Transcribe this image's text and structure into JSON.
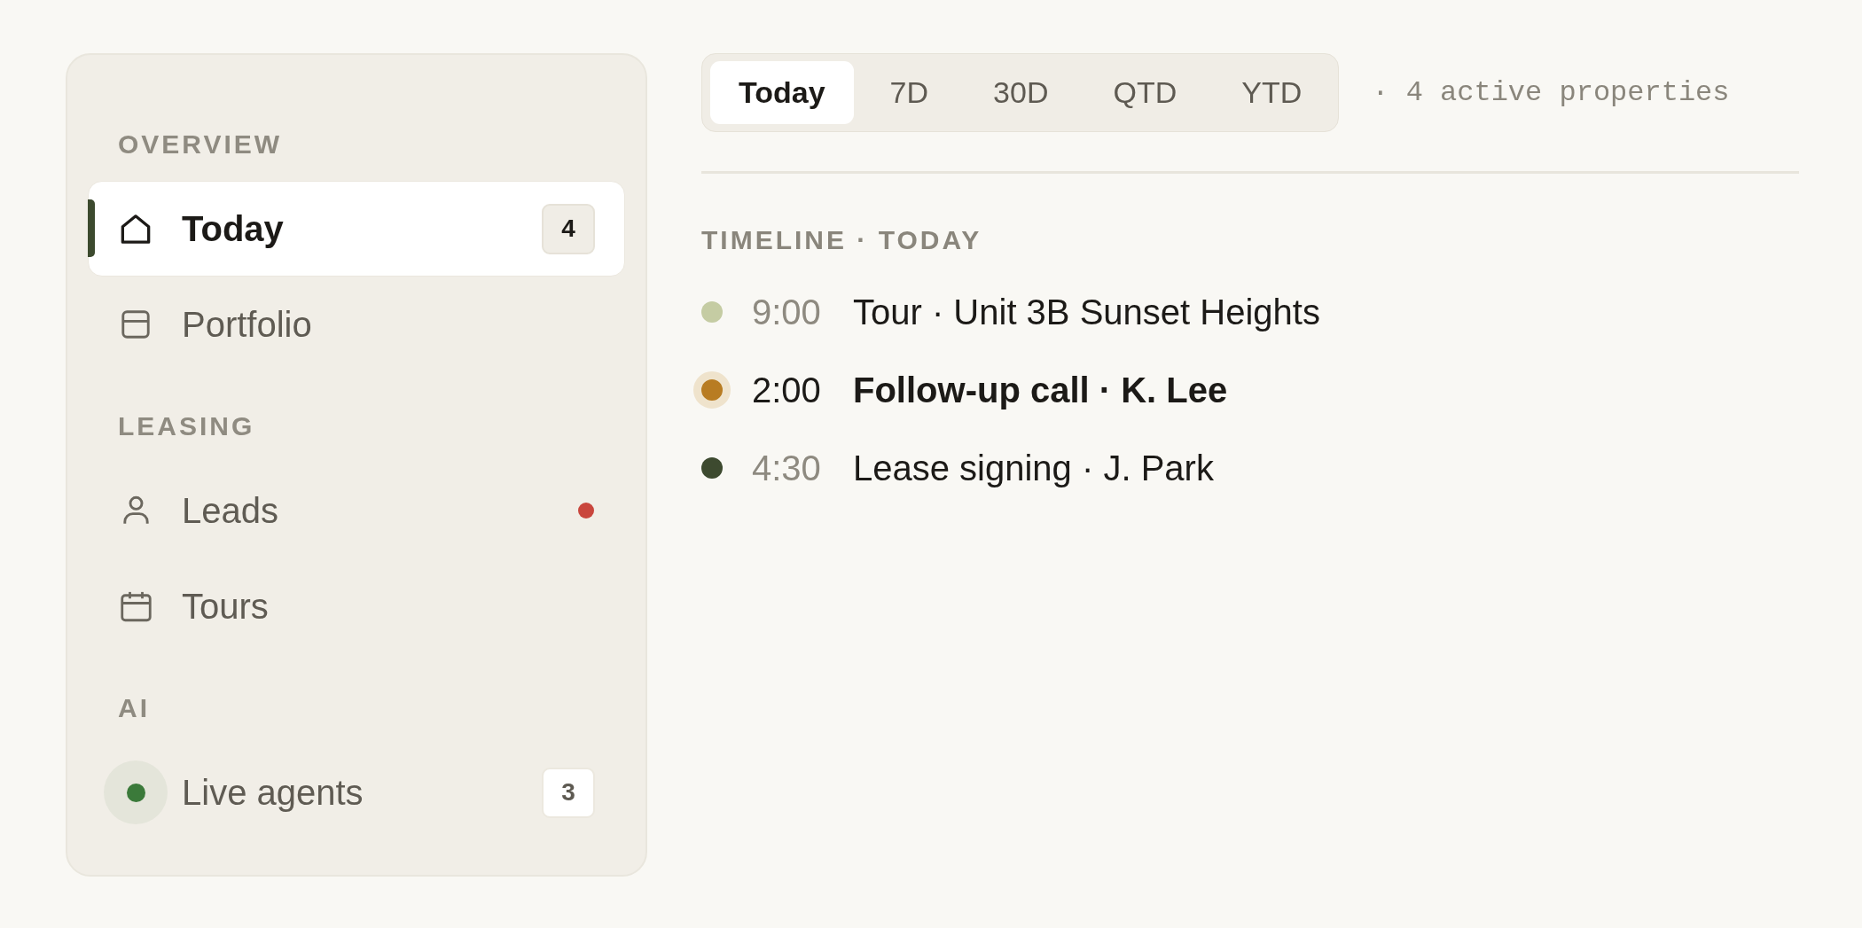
{
  "sidebar": {
    "sections": [
      {
        "title": "OVERVIEW",
        "items": [
          {
            "label": "Today",
            "selected": true,
            "badge": "4",
            "alert": false
          },
          {
            "label": "Portfolio",
            "selected": false,
            "alert": false
          }
        ]
      },
      {
        "title": "LEASING",
        "items": [
          {
            "label": "Leads",
            "selected": false,
            "alert": true
          },
          {
            "label": "Tours",
            "selected": false,
            "alert": false
          }
        ]
      },
      {
        "title": "AI",
        "items": [
          {
            "label": "Live agents",
            "selected": false,
            "badge": "3",
            "alert": false
          }
        ]
      }
    ]
  },
  "range_tabs": [
    {
      "label": "Today",
      "selected": true
    },
    {
      "label": "7D",
      "selected": false
    },
    {
      "label": "30D",
      "selected": false
    },
    {
      "label": "QTD",
      "selected": false
    },
    {
      "label": "YTD",
      "selected": false
    }
  ],
  "summary": "· 4 active properties",
  "timeline": {
    "title": "TIMELINE · TODAY",
    "events": [
      {
        "time": "9:00",
        "title": "Tour · Unit 3B Sunset Heights",
        "color": "#c5cca3",
        "current": false
      },
      {
        "time": "2:00",
        "title": "Follow-up call · K. Lee",
        "color": "#b87c22",
        "current": true
      },
      {
        "time": "4:30",
        "title": "Lease signing · J. Park",
        "color": "#3d4a2f",
        "current": false
      }
    ]
  }
}
